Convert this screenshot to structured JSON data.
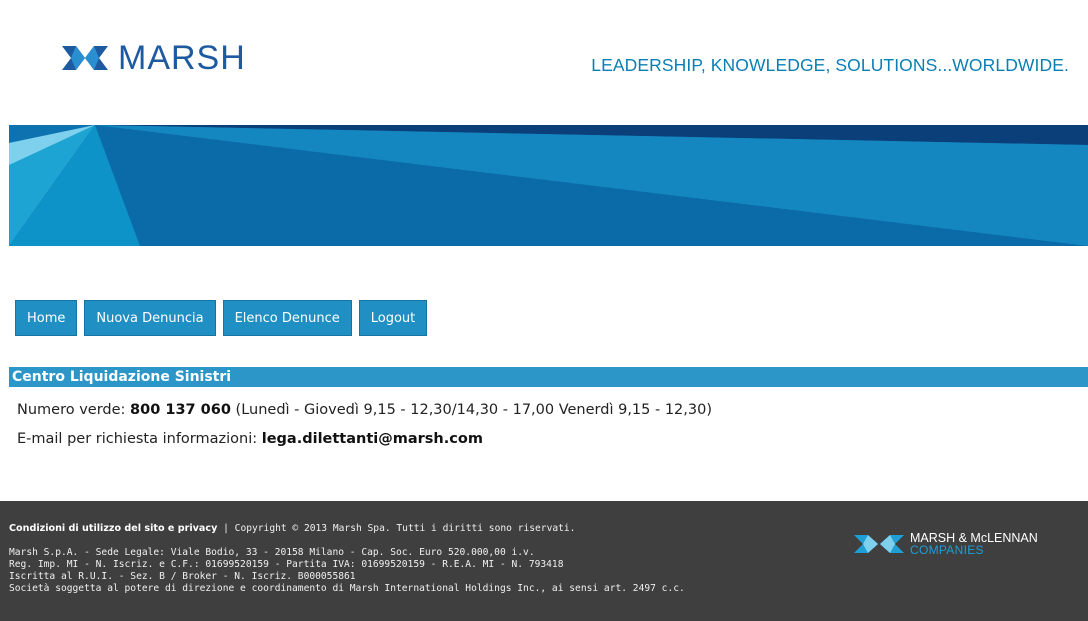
{
  "header": {
    "logo_text": "MARSH",
    "tagline": "LEADERSHIP, KNOWLEDGE, SOLUTIONS...WORLDWIDE."
  },
  "nav": {
    "items": [
      {
        "label": "Home"
      },
      {
        "label": "Nuova Denuncia"
      },
      {
        "label": "Elenco Denunce"
      },
      {
        "label": "Logout"
      }
    ]
  },
  "section": {
    "title": "Centro Liquidazione Sinistri",
    "phone_prefix": "Numero verde: ",
    "phone_number": "800 137 060",
    "phone_hours": " (Lunedì - Giovedì 9,15 - 12,30/14,30 - 17,00 Venerdì 9,15 - 12,30)",
    "email_prefix": "E-mail per richiesta informazioni: ",
    "email": "lega.dilettanti@marsh.com"
  },
  "footer": {
    "privacy_link": "Condizioni di utilizzo del sito e privacy",
    "copyright": " | Copyright © 2013 Marsh Spa. Tutti i diritti sono riservati.",
    "legal_lines": [
      "Marsh S.p.A. - Sede Legale: Viale Bodio, 33 - 20158 Milano - Cap. Soc. Euro 520.000,00 i.v.",
      "Reg. Imp. MI - N. Iscriz. e C.F.: 01699520159 - Partita IVA: 01699520159 - R.E.A. MI - N. 793418",
      "Iscritta al R.U.I. - Sez. B / Broker - N. Iscriz. B000055861",
      "Società soggetta al potere di direzione e coordinamento di Marsh International Holdings Inc., ai sensi art. 2497 c.c."
    ],
    "mm_logo_line1": "MARSH & McLENNAN",
    "mm_logo_line2": "COMPANIES"
  }
}
